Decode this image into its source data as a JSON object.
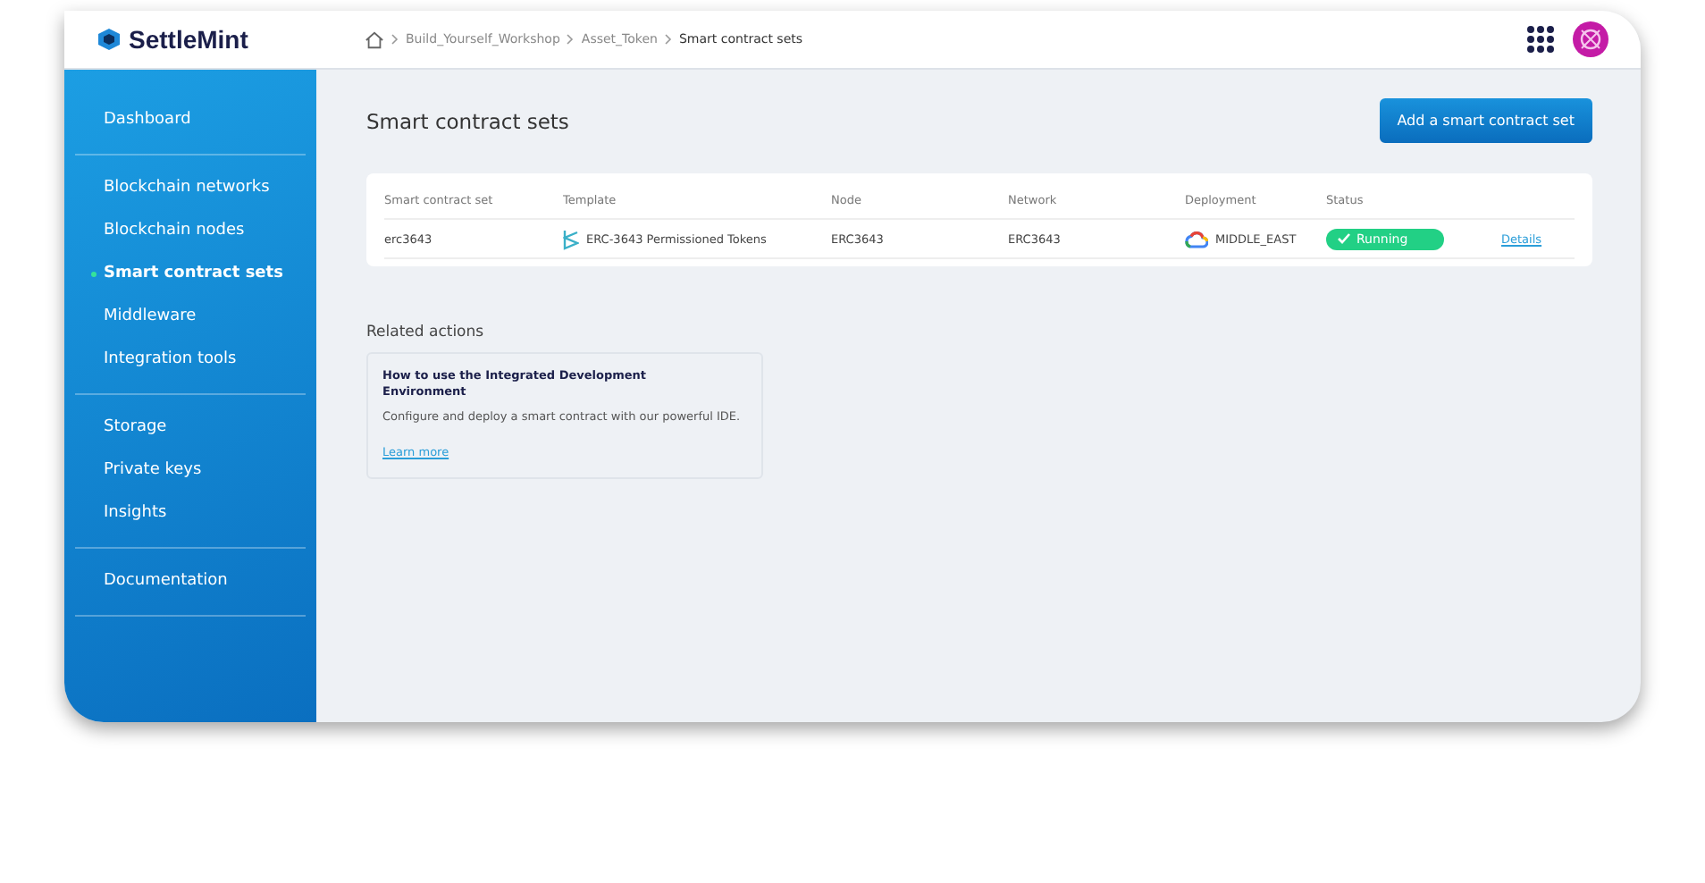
{
  "header": {
    "logo": "SettleMint",
    "breadcrumbs": [
      "Build_Yourself_Workshop",
      "Asset_Token",
      "Smart contract sets"
    ]
  },
  "sidebar": {
    "groups": [
      [
        {
          "label": "Dashboard",
          "selected": false
        }
      ],
      [
        {
          "label": "Blockchain networks",
          "selected": false
        },
        {
          "label": "Blockchain nodes",
          "selected": false
        },
        {
          "label": "Smart contract sets",
          "selected": true
        },
        {
          "label": "Middleware",
          "selected": false
        },
        {
          "label": "Integration tools",
          "selected": false
        }
      ],
      [
        {
          "label": "Storage",
          "selected": false
        },
        {
          "label": "Private keys",
          "selected": false
        },
        {
          "label": "Insights",
          "selected": false
        }
      ],
      [
        {
          "label": "Documentation",
          "selected": false
        }
      ]
    ]
  },
  "page": {
    "title": "Smart contract sets",
    "add_button": "Add a smart contract set"
  },
  "table": {
    "columns": [
      "Smart contract set",
      "Template",
      "Node",
      "Network",
      "Deployment",
      "Status"
    ],
    "rows": [
      {
        "name": "erc3643",
        "template": "ERC-3643 Permissioned Tokens",
        "node": "ERC3643",
        "network": "ERC3643",
        "deployment": "MIDDLE_EAST",
        "status": "Running",
        "kind": "running",
        "link": "Details"
      }
    ]
  },
  "related": {
    "title": "Related actions",
    "cards": [
      {
        "title": "How to use the Integrated Development Environment",
        "text": "Configure and deploy a smart contract with our powerful IDE.",
        "link": "Learn more"
      }
    ]
  }
}
